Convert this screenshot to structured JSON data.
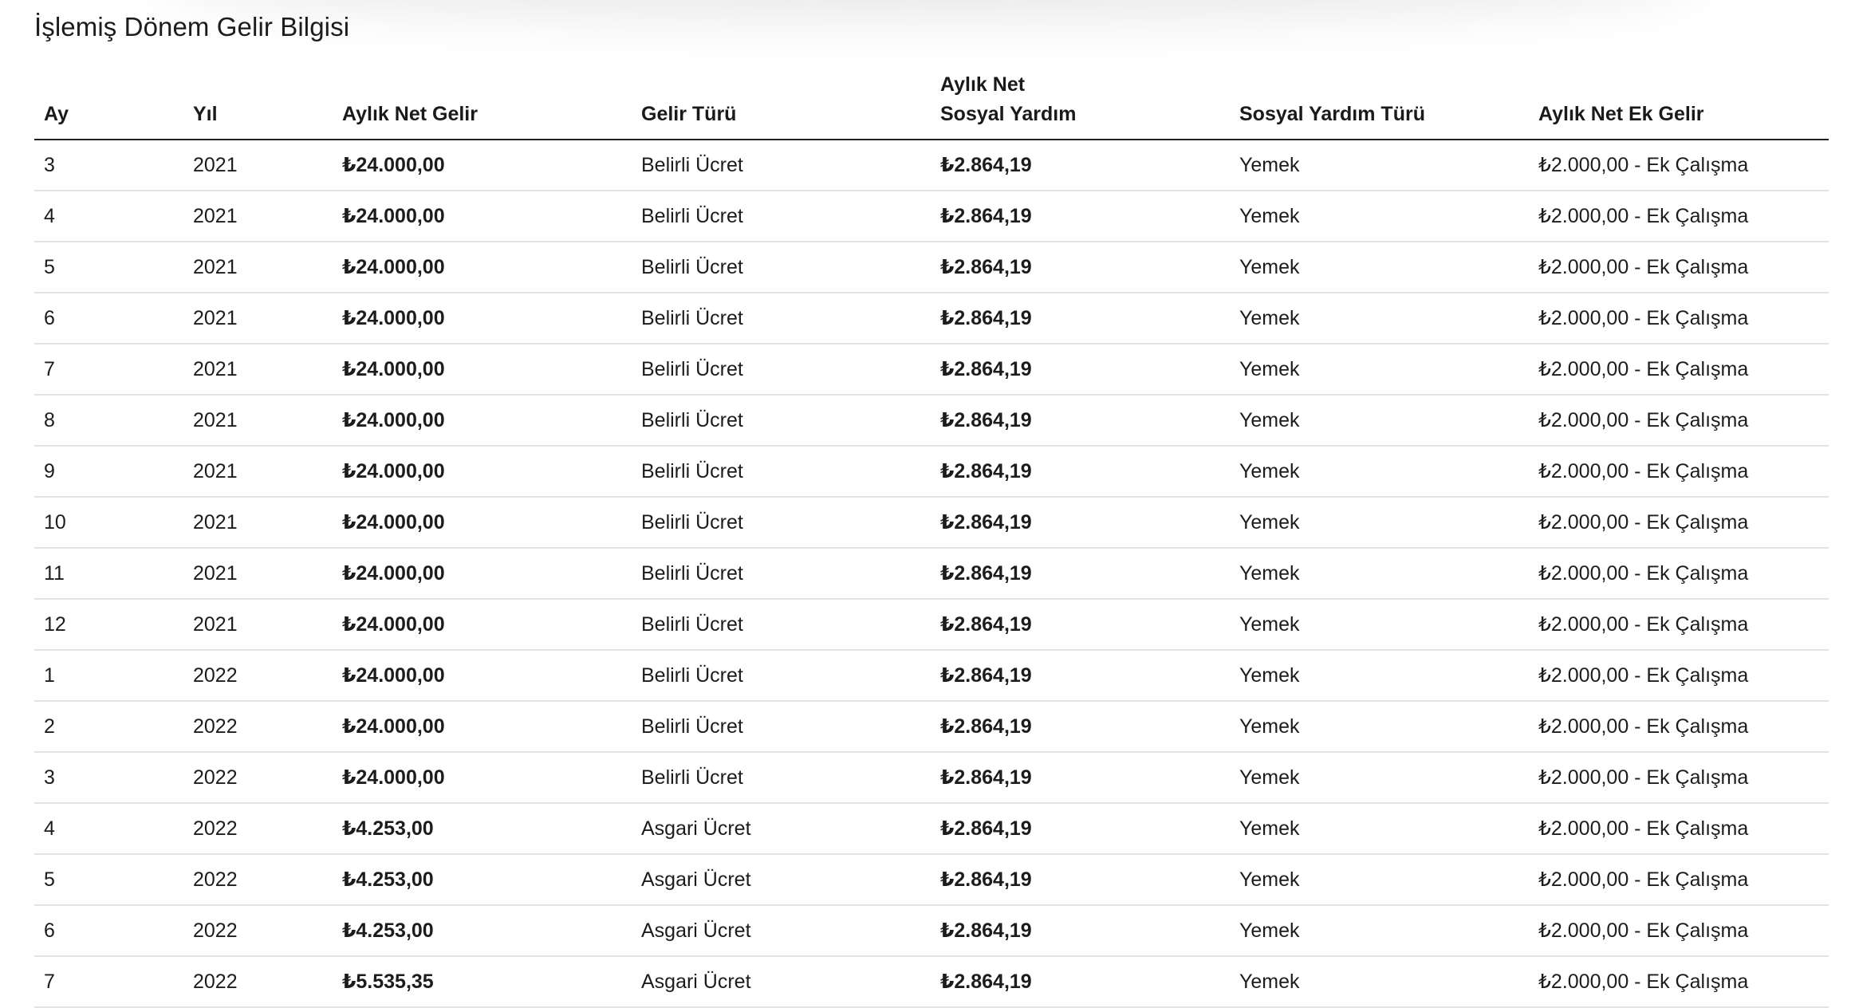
{
  "page": {
    "title": "İşlemiş Dönem Gelir Bilgisi"
  },
  "table": {
    "headers": {
      "ay": "Ay",
      "yil": "Yıl",
      "net_gelir": "Aylık Net Gelir",
      "gelir_turu": "Gelir Türü",
      "sosyal_yardim_line1": "Aylık Net",
      "sosyal_yardim_line2": "Sosyal Yardım",
      "sosyal_yardim_turu": "Sosyal Yardım Türü",
      "ek_gelir": "Aylık Net Ek Gelir"
    },
    "rows": [
      {
        "ay": "3",
        "yil": "2021",
        "net_gelir": "₺24.000,00",
        "gelir_turu": "Belirli Ücret",
        "sosyal_yardim": "₺2.864,19",
        "sosyal_yardim_turu": "Yemek",
        "ek_gelir": "₺2.000,00 - Ek Çalışma"
      },
      {
        "ay": "4",
        "yil": "2021",
        "net_gelir": "₺24.000,00",
        "gelir_turu": "Belirli Ücret",
        "sosyal_yardim": "₺2.864,19",
        "sosyal_yardim_turu": "Yemek",
        "ek_gelir": "₺2.000,00 - Ek Çalışma"
      },
      {
        "ay": "5",
        "yil": "2021",
        "net_gelir": "₺24.000,00",
        "gelir_turu": "Belirli Ücret",
        "sosyal_yardim": "₺2.864,19",
        "sosyal_yardim_turu": "Yemek",
        "ek_gelir": "₺2.000,00 - Ek Çalışma"
      },
      {
        "ay": "6",
        "yil": "2021",
        "net_gelir": "₺24.000,00",
        "gelir_turu": "Belirli Ücret",
        "sosyal_yardim": "₺2.864,19",
        "sosyal_yardim_turu": "Yemek",
        "ek_gelir": "₺2.000,00 - Ek Çalışma"
      },
      {
        "ay": "7",
        "yil": "2021",
        "net_gelir": "₺24.000,00",
        "gelir_turu": "Belirli Ücret",
        "sosyal_yardim": "₺2.864,19",
        "sosyal_yardim_turu": "Yemek",
        "ek_gelir": "₺2.000,00 - Ek Çalışma"
      },
      {
        "ay": "8",
        "yil": "2021",
        "net_gelir": "₺24.000,00",
        "gelir_turu": "Belirli Ücret",
        "sosyal_yardim": "₺2.864,19",
        "sosyal_yardim_turu": "Yemek",
        "ek_gelir": "₺2.000,00 - Ek Çalışma"
      },
      {
        "ay": "9",
        "yil": "2021",
        "net_gelir": "₺24.000,00",
        "gelir_turu": "Belirli Ücret",
        "sosyal_yardim": "₺2.864,19",
        "sosyal_yardim_turu": "Yemek",
        "ek_gelir": "₺2.000,00 - Ek Çalışma"
      },
      {
        "ay": "10",
        "yil": "2021",
        "net_gelir": "₺24.000,00",
        "gelir_turu": "Belirli Ücret",
        "sosyal_yardim": "₺2.864,19",
        "sosyal_yardim_turu": "Yemek",
        "ek_gelir": "₺2.000,00 - Ek Çalışma"
      },
      {
        "ay": "11",
        "yil": "2021",
        "net_gelir": "₺24.000,00",
        "gelir_turu": "Belirli Ücret",
        "sosyal_yardim": "₺2.864,19",
        "sosyal_yardim_turu": "Yemek",
        "ek_gelir": "₺2.000,00 - Ek Çalışma"
      },
      {
        "ay": "12",
        "yil": "2021",
        "net_gelir": "₺24.000,00",
        "gelir_turu": "Belirli Ücret",
        "sosyal_yardim": "₺2.864,19",
        "sosyal_yardim_turu": "Yemek",
        "ek_gelir": "₺2.000,00 - Ek Çalışma"
      },
      {
        "ay": "1",
        "yil": "2022",
        "net_gelir": "₺24.000,00",
        "gelir_turu": "Belirli Ücret",
        "sosyal_yardim": "₺2.864,19",
        "sosyal_yardim_turu": "Yemek",
        "ek_gelir": "₺2.000,00 - Ek Çalışma"
      },
      {
        "ay": "2",
        "yil": "2022",
        "net_gelir": "₺24.000,00",
        "gelir_turu": "Belirli Ücret",
        "sosyal_yardim": "₺2.864,19",
        "sosyal_yardim_turu": "Yemek",
        "ek_gelir": "₺2.000,00 - Ek Çalışma"
      },
      {
        "ay": "3",
        "yil": "2022",
        "net_gelir": "₺24.000,00",
        "gelir_turu": "Belirli Ücret",
        "sosyal_yardim": "₺2.864,19",
        "sosyal_yardim_turu": "Yemek",
        "ek_gelir": "₺2.000,00 - Ek Çalışma"
      },
      {
        "ay": "4",
        "yil": "2022",
        "net_gelir": "₺4.253,00",
        "gelir_turu": "Asgari Ücret",
        "sosyal_yardim": "₺2.864,19",
        "sosyal_yardim_turu": "Yemek",
        "ek_gelir": "₺2.000,00 - Ek Çalışma"
      },
      {
        "ay": "5",
        "yil": "2022",
        "net_gelir": "₺4.253,00",
        "gelir_turu": "Asgari Ücret",
        "sosyal_yardim": "₺2.864,19",
        "sosyal_yardim_turu": "Yemek",
        "ek_gelir": "₺2.000,00 - Ek Çalışma"
      },
      {
        "ay": "6",
        "yil": "2022",
        "net_gelir": "₺4.253,00",
        "gelir_turu": "Asgari Ücret",
        "sosyal_yardim": "₺2.864,19",
        "sosyal_yardim_turu": "Yemek",
        "ek_gelir": "₺2.000,00 - Ek Çalışma"
      },
      {
        "ay": "7",
        "yil": "2022",
        "net_gelir": "₺5.535,35",
        "gelir_turu": "Asgari Ücret",
        "sosyal_yardim": "₺2.864,19",
        "sosyal_yardim_turu": "Yemek",
        "ek_gelir": "₺2.000,00 - Ek Çalışma"
      }
    ]
  }
}
